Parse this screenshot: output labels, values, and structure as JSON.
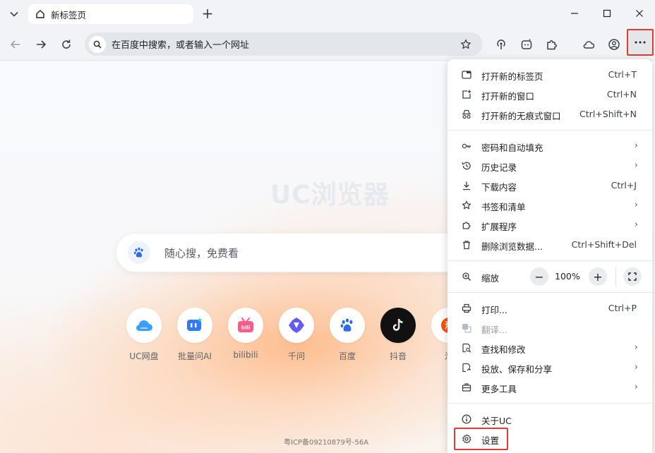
{
  "tab": {
    "title": "新标签页"
  },
  "omnibox": {
    "placeholder": "在百度中搜索，或者输入一个网址"
  },
  "page": {
    "brand": "UC浏览器",
    "search_placeholder": "随心搜，免费看",
    "footer": "粤ICP备09210879号-56A",
    "shortcuts": [
      {
        "label": "UC网盘",
        "icon": "cloud-drive-icon",
        "color": "#3aa0ff"
      },
      {
        "label": "批量问AI",
        "icon": "ai-chat-icon",
        "color": "#2f7bff"
      },
      {
        "label": "bilibili",
        "icon": "bilibili-icon",
        "color": "#ff5c8a"
      },
      {
        "label": "千问",
        "icon": "qianwen-icon",
        "color": "#615ced"
      },
      {
        "label": "百度",
        "icon": "baidu-icon",
        "color": "#2f6be6"
      },
      {
        "label": "抖音",
        "icon": "douyin-icon",
        "color": "#111111"
      },
      {
        "label": "淘",
        "icon": "taobao-icon",
        "color": "#ff5000"
      }
    ]
  },
  "menu": {
    "items": [
      {
        "label": "打开新的标签页",
        "shortcut": "Ctrl+T",
        "icon": "new-tab-icon"
      },
      {
        "label": "打开新的窗口",
        "shortcut": "Ctrl+N",
        "icon": "new-window-icon"
      },
      {
        "label": "打开新的无痕式窗口",
        "shortcut": "Ctrl+Shift+N",
        "icon": "incognito-icon"
      },
      {
        "label": "密码和自动填充",
        "shortcut": "",
        "icon": "key-icon"
      },
      {
        "label": "历史记录",
        "shortcut": "",
        "icon": "history-icon"
      },
      {
        "label": "下载内容",
        "shortcut": "Ctrl+J",
        "icon": "download-icon"
      },
      {
        "label": "书签和清单",
        "shortcut": "",
        "icon": "star-icon"
      },
      {
        "label": "扩展程序",
        "shortcut": "",
        "icon": "puzzle-icon"
      },
      {
        "label": "删除浏览数据...",
        "shortcut": "Ctrl+Shift+Del",
        "icon": "trash-icon"
      },
      {
        "label": "缩放",
        "shortcut": "",
        "icon": "zoom-icon"
      },
      {
        "label": "打印...",
        "shortcut": "Ctrl+P",
        "icon": "print-icon"
      },
      {
        "label": "翻译...",
        "shortcut": "",
        "icon": "translate-icon"
      },
      {
        "label": "查找和修改",
        "shortcut": "",
        "icon": "find-icon"
      },
      {
        "label": "投放、保存和分享",
        "shortcut": "",
        "icon": "cast-icon"
      },
      {
        "label": "更多工具",
        "shortcut": "",
        "icon": "toolbox-icon"
      },
      {
        "label": "关于UC",
        "shortcut": "",
        "icon": "info-icon"
      },
      {
        "label": "设置",
        "shortcut": "",
        "icon": "gear-icon"
      }
    ],
    "zoom": {
      "minus": "−",
      "value": "100%",
      "plus": "+"
    }
  },
  "colors": {
    "highlight": "#e53935",
    "accent": "#1a73e8"
  }
}
